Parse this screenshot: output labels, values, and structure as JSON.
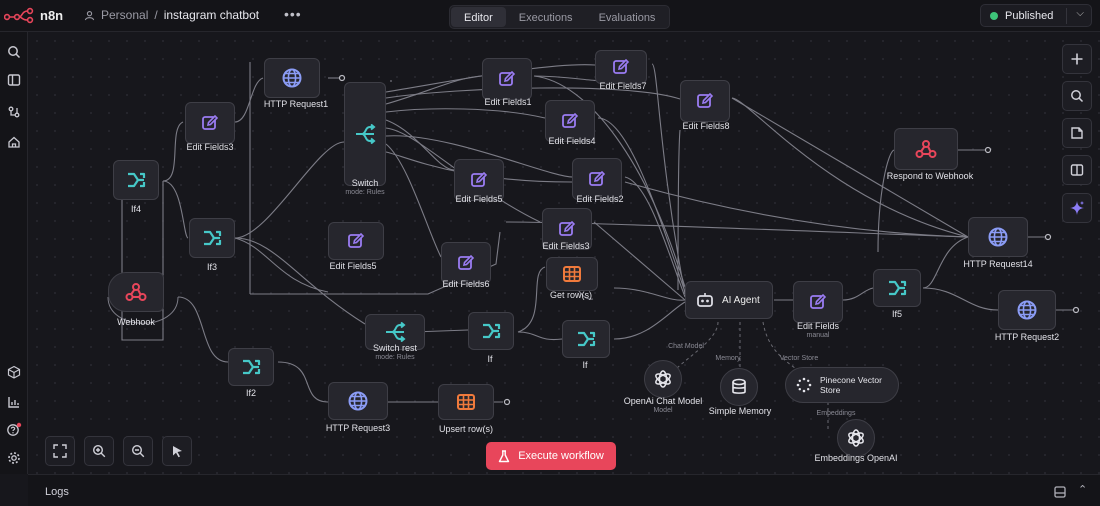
{
  "app": {
    "name": "n8n"
  },
  "breadcrumb": {
    "project": "Personal",
    "separator": "/",
    "workflow": "instagram chatbot"
  },
  "more_label": "•••",
  "tabs": [
    "Editor",
    "Executions",
    "Evaluations"
  ],
  "active_tab": "Editor",
  "publish": {
    "label": "Published",
    "status_color": "#3ec47a"
  },
  "colors": {
    "accent": "#e8465b",
    "edit_icon": "#9a7cf2",
    "switch_icon": "#46c8c8",
    "webhook_icon": "#e8465b",
    "globe_icon": "#8b9cf5",
    "table_icon": "#f07a3c"
  },
  "sidebar_icons": [
    "search-icon",
    "panel-icon",
    "templates-icon",
    "home-icon",
    "box-icon",
    "chart-icon",
    "help-icon",
    "settings-icon"
  ],
  "nodes": {
    "http_request1": {
      "label": "HTTP Request1",
      "icon": "globe-icon"
    },
    "edit_fields3": {
      "label": "Edit Fields3",
      "icon": "pencil-icon"
    },
    "if4": {
      "label": "If4",
      "icon": "branch-icon"
    },
    "if3": {
      "label": "If3",
      "icon": "branch-icon"
    },
    "webhook": {
      "label": "Webhook",
      "icon": "webhook-icon"
    },
    "if2": {
      "label": "If2",
      "icon": "branch-icon"
    },
    "switch": {
      "label": "Switch",
      "sub": "mode: Rules",
      "icon": "switch-icon"
    },
    "edit_fields5a": {
      "label": "Edit Fields5",
      "icon": "pencil-icon"
    },
    "edit_fields5b": {
      "label": "Edit Fields5",
      "icon": "pencil-icon"
    },
    "edit_fields1": {
      "label": "Edit Fields1",
      "icon": "pencil-icon"
    },
    "edit_fields4": {
      "label": "Edit Fields4",
      "icon": "pencil-icon"
    },
    "edit_fields6": {
      "label": "Edit Fields6",
      "icon": "pencil-icon"
    },
    "edit_fields7": {
      "label": "Edit Fields7",
      "icon": "pencil-icon"
    },
    "edit_fields8": {
      "label": "Edit Fields8",
      "icon": "pencil-icon"
    },
    "edit_fields2": {
      "label": "Edit Fields2",
      "icon": "pencil-icon"
    },
    "edit_fields3b": {
      "label": "Edit Fields3",
      "icon": "pencil-icon"
    },
    "get_rows": {
      "label": "Get row(s)",
      "icon": "table-icon"
    },
    "switch_rest": {
      "label": "Switch rest",
      "sub": "mode: Rules",
      "icon": "switch-icon"
    },
    "if": {
      "label": "If",
      "icon": "branch-icon"
    },
    "if_b": {
      "label": "If",
      "icon": "branch-icon"
    },
    "http_request3": {
      "label": "HTTP Request3",
      "icon": "globe-icon"
    },
    "upsert_rows": {
      "label": "Upsert row(s)",
      "icon": "table-icon"
    },
    "ai_agent": {
      "label": "AI Agent",
      "icon": "robot-icon"
    },
    "edit_fields": {
      "label": "Edit Fields",
      "sub": "manual",
      "icon": "pencil-icon"
    },
    "if5": {
      "label": "If5",
      "icon": "branch-icon"
    },
    "respond_webhook": {
      "label": "Respond to Webhook",
      "icon": "webhook-icon"
    },
    "http_request14": {
      "label": "HTTP Request14",
      "icon": "globe-icon"
    },
    "http_request2": {
      "label": "HTTP Request2",
      "icon": "globe-icon"
    },
    "openai_chat": {
      "label": "OpenAi Chat Model",
      "sub": "Model",
      "icon": "openai-icon"
    },
    "simple_memory": {
      "label": "Simple Memory",
      "icon": "database-icon"
    },
    "pinecone": {
      "label": "Pinecone Vector Store",
      "icon": "pinecone-icon"
    },
    "embeddings": {
      "label": "Embeddings OpenAI",
      "icon": "openai-icon"
    }
  },
  "connector_labels": {
    "chat_model": "Chat Model",
    "memory": "Memory",
    "vector_store": "Vector Store",
    "embeddings": "Embeddings"
  },
  "execute_button": {
    "label": "Execute workflow",
    "icon": "flask-icon"
  },
  "canvas_controls": [
    "fit-view-icon",
    "zoom-in-icon",
    "zoom-out-icon",
    "tidy-up-icon"
  ],
  "right_tools": [
    "plus-icon",
    "search-icon",
    "sticky-note-icon",
    "panel-icon",
    "sparkle-icon"
  ],
  "logs": {
    "label": "Logs"
  }
}
